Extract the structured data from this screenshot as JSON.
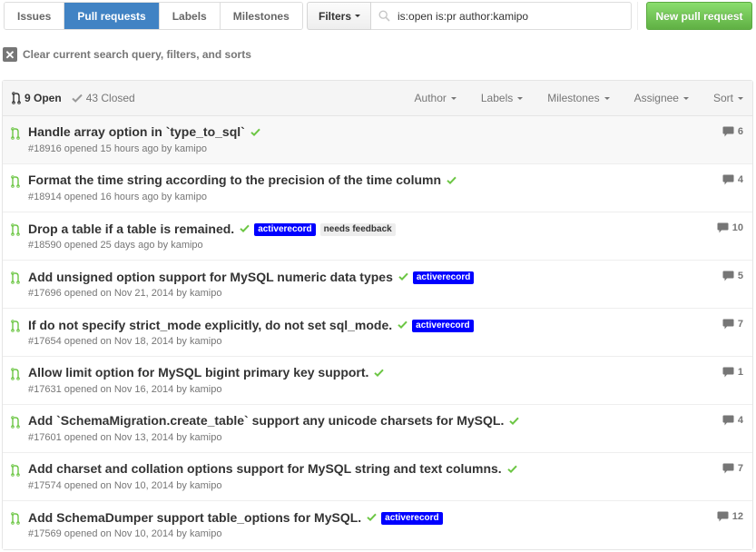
{
  "subnav": {
    "items": [
      {
        "label": "Issues",
        "selected": false
      },
      {
        "label": "Pull requests",
        "selected": true
      },
      {
        "label": "Labels",
        "selected": false
      },
      {
        "label": "Milestones",
        "selected": false
      }
    ]
  },
  "filters": {
    "button_label": "Filters",
    "search_value": "is:open is:pr author:kamipo",
    "search_icon": "search-icon"
  },
  "new_pr_button": "New pull request",
  "clear_query": {
    "icon": "close-icon",
    "label": "Clear current search query, filters, and sorts"
  },
  "listing_header": {
    "open_label": "9 Open",
    "closed_label": "43 Closed",
    "filters": [
      "Author",
      "Labels",
      "Milestones",
      "Assignee",
      "Sort"
    ]
  },
  "colors": {
    "selected_tab": "#4183c4",
    "new_pr_green": "#60b044",
    "check_green": "#6cc644",
    "activerecord_label": "#0000ff",
    "needs_feedback_label": "#ededed"
  },
  "pull_requests": [
    {
      "title": "Handle array option in `type_to_sql`",
      "meta_prefix": "#18916 opened 15 hours ago by ",
      "author": "kamipo",
      "labels": [],
      "comments": "6"
    },
    {
      "title": "Format the time string according to the precision of the time column",
      "meta_prefix": "#18914 opened 16 hours ago by ",
      "author": "kamipo",
      "labels": [],
      "comments": "4"
    },
    {
      "title": "Drop a table if a table is remained.",
      "meta_prefix": "#18590 opened 25 days ago by ",
      "author": "kamipo",
      "labels": [
        "activerecord",
        "needs feedback"
      ],
      "comments": "10"
    },
    {
      "title": "Add unsigned option support for MySQL numeric data types",
      "meta_prefix": "#17696 opened on Nov 21, 2014 by ",
      "author": "kamipo",
      "labels": [
        "activerecord"
      ],
      "comments": "5"
    },
    {
      "title": "If do not specify strict_mode explicitly, do not set sql_mode.",
      "meta_prefix": "#17654 opened on Nov 18, 2014 by ",
      "author": "kamipo",
      "labels": [
        "activerecord"
      ],
      "comments": "7"
    },
    {
      "title": "Allow limit option for MySQL bigint primary key support.",
      "meta_prefix": "#17631 opened on Nov 16, 2014 by ",
      "author": "kamipo",
      "labels": [],
      "comments": "1"
    },
    {
      "title": "Add `SchemaMigration.create_table` support any unicode charsets for MySQL.",
      "meta_prefix": "#17601 opened on Nov 13, 2014 by ",
      "author": "kamipo",
      "labels": [],
      "comments": "4"
    },
    {
      "title": "Add charset and collation options support for MySQL string and text columns.",
      "meta_prefix": "#17574 opened on Nov 10, 2014 by ",
      "author": "kamipo",
      "labels": [],
      "comments": "7"
    },
    {
      "title": "Add SchemaDumper support table_options for MySQL.",
      "meta_prefix": "#17569 opened on Nov 10, 2014 by ",
      "author": "kamipo",
      "labels": [
        "activerecord"
      ],
      "comments": "12"
    }
  ]
}
